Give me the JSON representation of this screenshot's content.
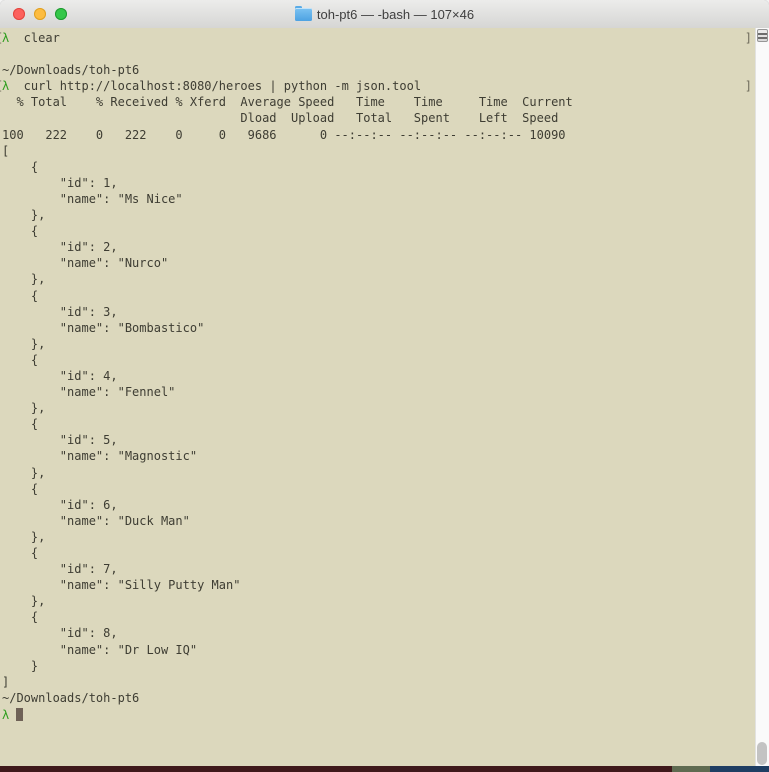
{
  "window": {
    "title": "toh-pt6 — -bash — 107×46",
    "folder_name": "toh-pt6",
    "shell": "-bash",
    "grid_size": "107×46",
    "traffic_lights": {
      "close": "close",
      "minimize": "minimize",
      "zoom": "zoom"
    }
  },
  "terminal": {
    "prompt_symbol": "λ",
    "mark_left": "[",
    "mark_right": "]",
    "cwd": "~/Downloads/toh-pt6",
    "colors": {
      "background": "#dcd8bd",
      "foreground": "#3e3d33",
      "prompt_green": "#2f9e1e",
      "cursor": "#6e6156",
      "mark": "#6f6b5c"
    },
    "heroes": [
      {
        "id": 1,
        "name": "Ms Nice"
      },
      {
        "id": 2,
        "name": "Nurco"
      },
      {
        "id": 3,
        "name": "Bombastico"
      },
      {
        "id": 4,
        "name": "Fennel"
      },
      {
        "id": 5,
        "name": "Magnostic"
      },
      {
        "id": 6,
        "name": "Duck Man"
      },
      {
        "id": 7,
        "name": "Silly Putty Man"
      },
      {
        "id": 8,
        "name": "Dr Low IQ"
      }
    ],
    "lines": [
      {
        "k": "cmd",
        "t": "clear"
      },
      {
        "k": "blank"
      },
      {
        "k": "out",
        "t": "~/Downloads/toh-pt6"
      },
      {
        "k": "cmd",
        "t": "curl http://localhost:8080/heroes | python -m json.tool"
      },
      {
        "k": "out",
        "t": "  % Total    % Received % Xferd  Average Speed   Time    Time     Time  Current"
      },
      {
        "k": "out",
        "t": "                                 Dload  Upload   Total   Spent    Left  Speed"
      },
      {
        "k": "out",
        "t": "100   222    0   222    0     0   9686      0 --:--:-- --:--:-- --:--:-- 10090"
      },
      {
        "k": "json-array"
      },
      {
        "k": "out",
        "t": "~/Downloads/toh-pt6"
      },
      {
        "k": "prompt"
      }
    ]
  }
}
